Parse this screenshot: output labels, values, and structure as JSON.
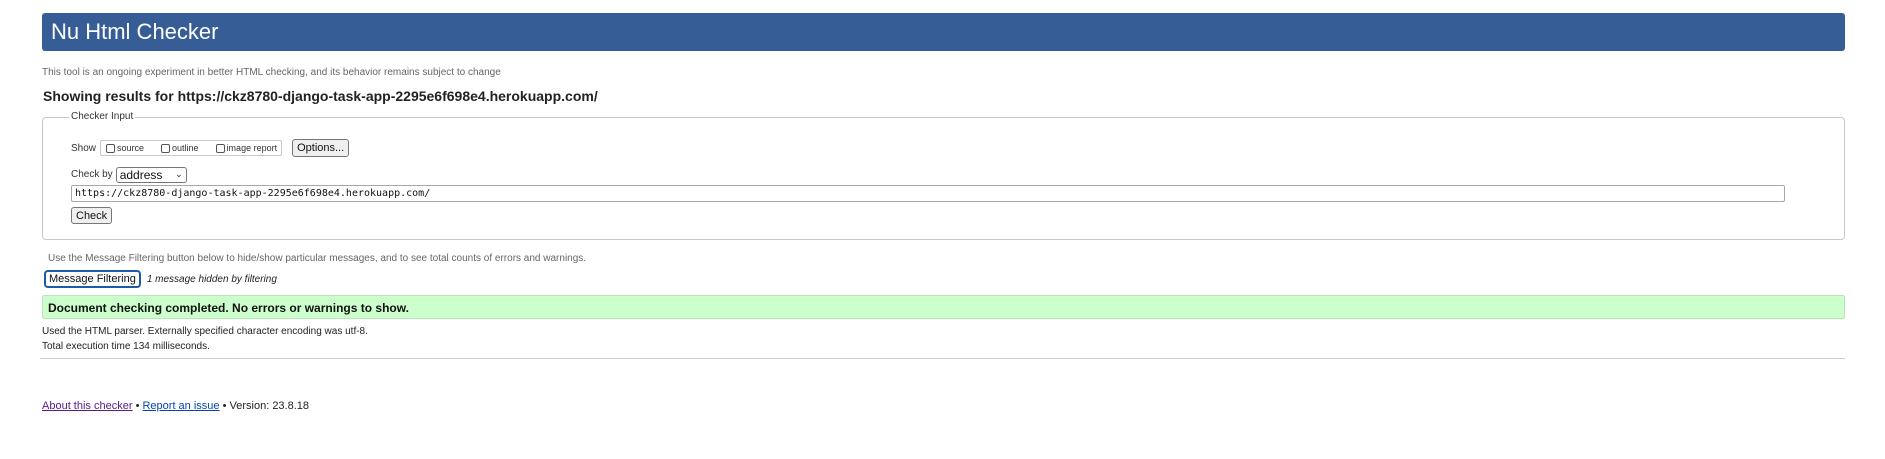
{
  "header": {
    "title": "Nu Html Checker",
    "tagline": "This tool is an ongoing experiment in better HTML checking, and its behavior remains subject to change",
    "showing_results": "Showing results for https://ckz8780-django-task-app-2295e6f698e4.herokuapp.com/"
  },
  "checker_input": {
    "legend": "Checker Input",
    "show_label": "Show",
    "options": [
      {
        "label": "source",
        "checked": false
      },
      {
        "label": "outline",
        "checked": false
      },
      {
        "label": "image report",
        "checked": false
      }
    ],
    "options_button": "Options...",
    "check_by_label": "Check by",
    "check_by_value": "address",
    "url_value": "https://ckz8780-django-task-app-2295e6f698e4.herokuapp.com/",
    "check_button": "Check"
  },
  "filtering": {
    "hint": "Use the Message Filtering button below to hide/show particular messages, and to see total counts of errors and warnings.",
    "button": "Message Filtering",
    "hidden_note": "1 message hidden by filtering"
  },
  "results": {
    "success_message": "Document checking completed. No errors or warnings to show.",
    "parser_info": "Used the HTML parser. Externally specified character encoding was utf-8.",
    "execution_time": "Total execution time 134 milliseconds."
  },
  "footer": {
    "about_link": "About this checker",
    "separator": "•",
    "report_link": "Report an issue",
    "version": "Version: 23.8.18"
  },
  "colors": {
    "banner": "#365d95",
    "success_bg": "#ccffcc"
  }
}
